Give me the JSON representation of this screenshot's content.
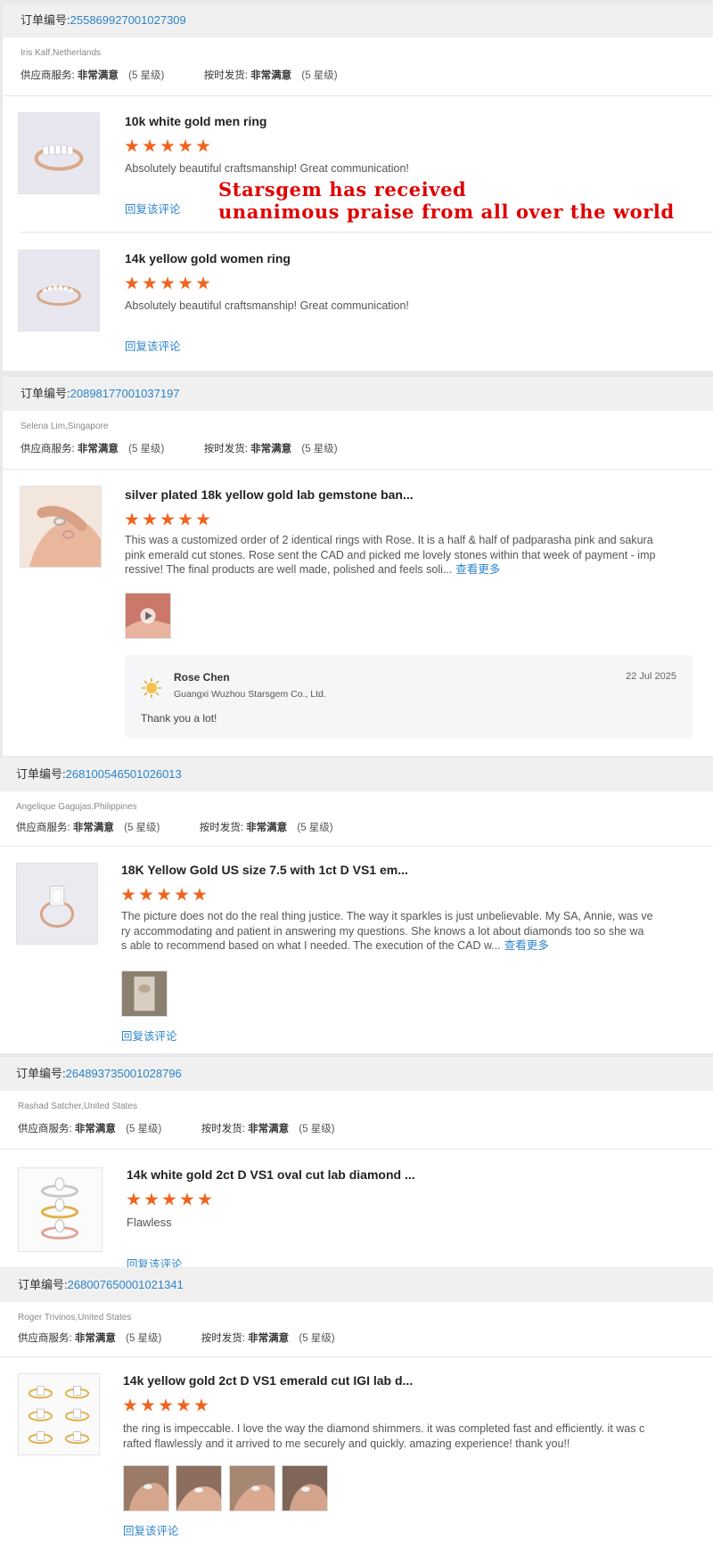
{
  "labels": {
    "order_prefix": "订单编号:",
    "supplier_service": "供应商服务:",
    "on_time_delivery": "按时发货:",
    "reply_review": "回复该评论",
    "see_more": "查看更多"
  },
  "overlay": {
    "line1": "Starsgem has received",
    "line2": "unanimous praise from all over the world",
    "color": "#e00000"
  },
  "orders": [
    {
      "order_no": "255869927001027309",
      "buyer": "Iris Kalf,Netherlands",
      "service_value": "非常满意",
      "service_level": "(5 星级)",
      "delivery_value": "非常满意",
      "delivery_level": "(5 星级)",
      "items": [
        {
          "title": "10k white gold men ring",
          "stars": 5,
          "comment": "Absolutely beautiful craftsmanship! Great communication!"
        },
        {
          "title": "14k yellow gold women ring",
          "stars": 5,
          "comment": "Absolutely beautiful craftsmanship! Great communication!"
        }
      ]
    },
    {
      "order_no": "208981770010371​97",
      "buyer": "Selena Lim,Singapore",
      "service_value": "非常满意",
      "service_level": "(5 星级)",
      "delivery_value": "非常满意",
      "delivery_level": "(5 星级)",
      "items": [
        {
          "title": "silver plated 18k yellow gold lab gemstone ban...",
          "stars": 5,
          "comment_lines": [
            "This was a customized order of 2 identical rings with Rose. It is a half & half of padparasha pink and sakura",
            "pink emerald cut stones. Rose sent the CAD and picked me lovely stones within that week of payment - imp",
            "ressive! The final products are well made, polished and feels soli..."
          ]
        }
      ],
      "seller_reply": {
        "name": "Rose Chen",
        "company": "Guangxi Wuzhou Starsgem Co., Ltd.",
        "date": "22 Jul 2025",
        "message": "Thank you a lot!"
      }
    },
    {
      "order_no": "268100546501026013",
      "buyer": "Angelique Gagujas,Philippines",
      "service_value": "非常满意",
      "service_level": "(5 星级)",
      "delivery_value": "非常满意",
      "delivery_level": "(5 星级)",
      "items": [
        {
          "title": "18K Yellow Gold US size 7.5 with 1ct D VS1 em...",
          "stars": 5,
          "comment_lines": [
            "The picture does not do the real thing justice. The way it sparkles is just unbelievable. My SA, Annie, was ve",
            "ry accommodating and patient in answering my questions. She knows a lot about diamonds too so she wa",
            "s able to recommend based on what I needed. The execution of the CAD w..."
          ]
        }
      ]
    },
    {
      "order_no": "264893735001028796",
      "buyer": "Rashad Satcher,United States",
      "service_value": "非常满意",
      "service_level": "(5 星级)",
      "delivery_value": "非常满意",
      "delivery_level": "(5 星级)",
      "items": [
        {
          "title": "14k white gold 2ct D VS1 oval cut lab diamond ...",
          "stars": 5,
          "comment": "Flawless"
        }
      ]
    },
    {
      "order_no": "268007650001021341",
      "buyer": "Roger Trivinos,United States",
      "service_value": "非常满意",
      "service_level": "(5 星级)",
      "delivery_value": "非常满意",
      "delivery_level": "(5 星级)",
      "items": [
        {
          "title": "14k yellow gold 2ct D VS1 emerald cut IGI lab d...",
          "stars": 5,
          "comment_lines": [
            "the ring is impeccable. I love the way the diamond shimmers. it was completed fast and efficiently. it was c",
            "rafted flawlessly and it arrived to me securely and quickly. amazing experience! thank you!!"
          ]
        }
      ]
    }
  ]
}
